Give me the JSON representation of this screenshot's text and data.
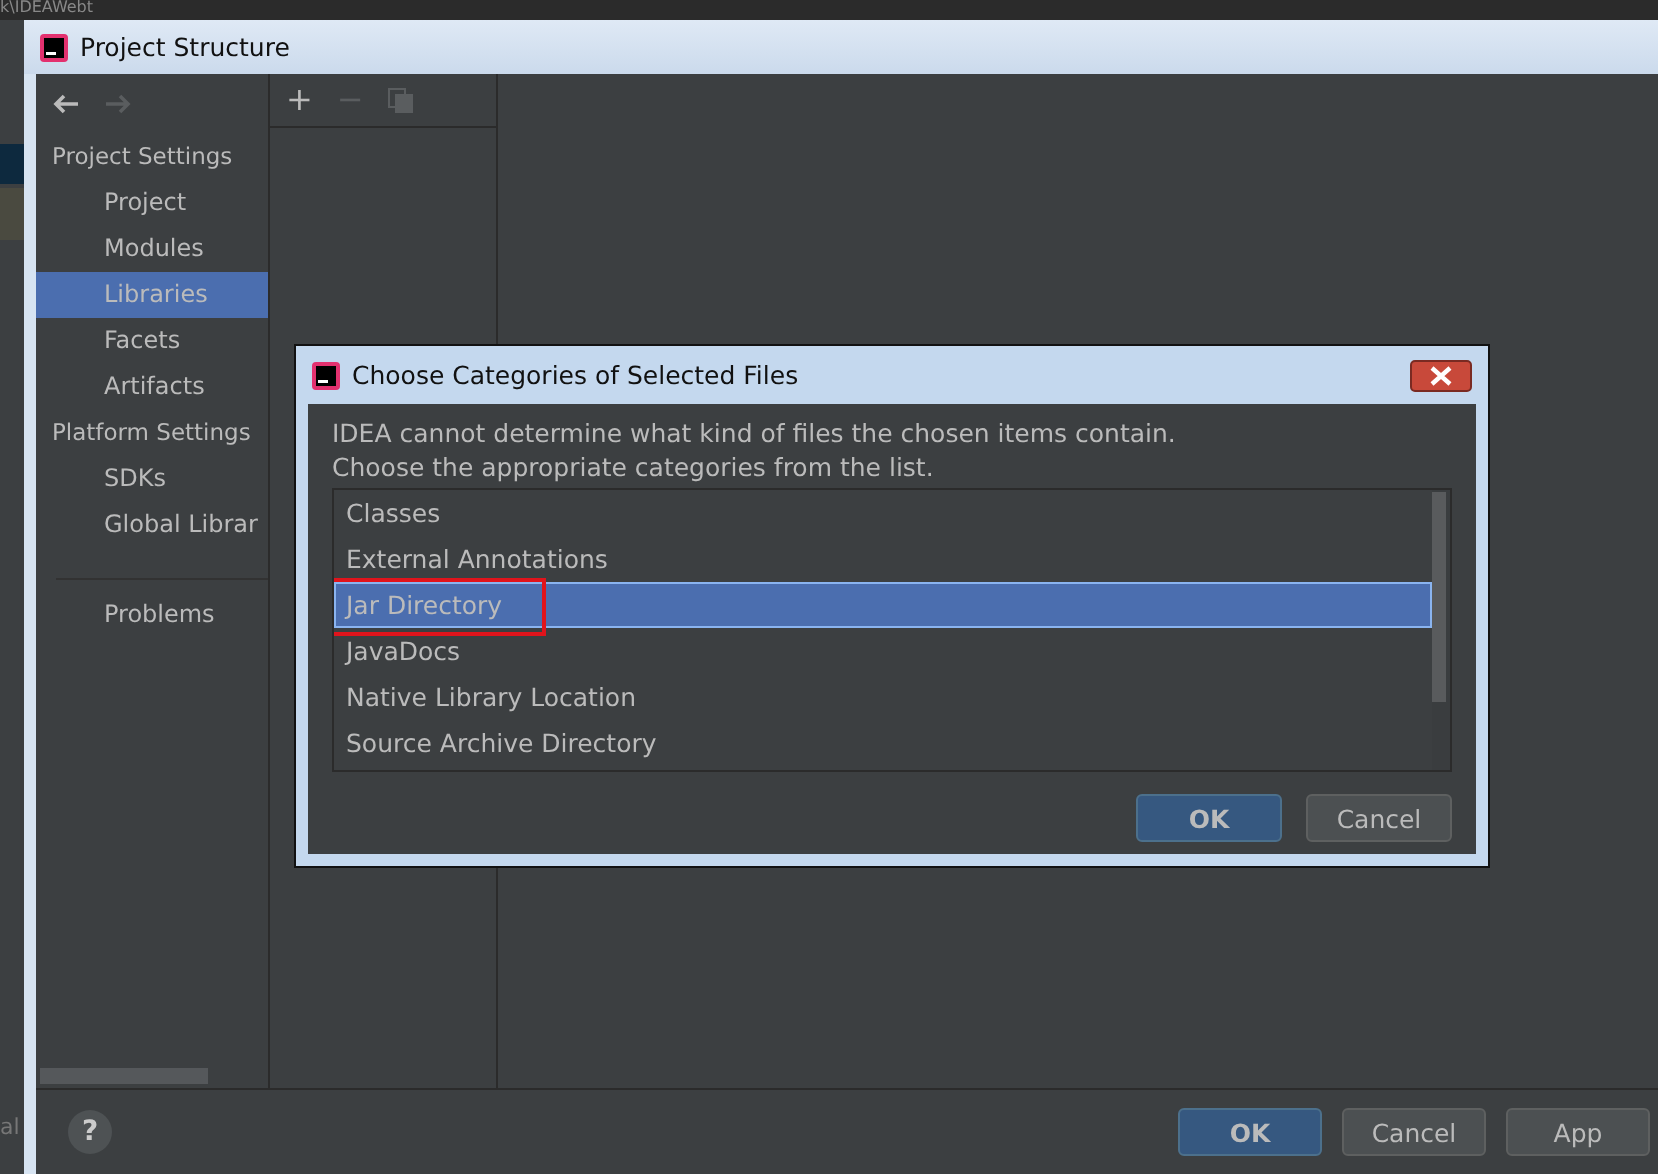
{
  "ide": {
    "path": "k\\IDEAWebt",
    "fragment": "al"
  },
  "window": {
    "title": "Project Structure"
  },
  "toolbar": [
    "+",
    "−"
  ],
  "sidebar": [
    {
      "heading": "Project Settings",
      "items": [
        {
          "label": "Project",
          "selected": false
        },
        {
          "label": "Modules",
          "selected": false
        },
        {
          "label": "Libraries",
          "selected": true
        },
        {
          "label": "Facets",
          "selected": false
        },
        {
          "label": "Artifacts",
          "selected": false
        }
      ]
    },
    {
      "heading": "Platform Settings",
      "items": [
        {
          "label": "SDKs",
          "selected": false
        },
        {
          "label": "Global Librar",
          "selected": false
        }
      ]
    },
    {
      "items": [
        {
          "label": "Problems",
          "selected": false
        }
      ]
    }
  ],
  "dialog": {
    "title": "Choose Categories of Selected Files",
    "message": [
      "IDEA cannot determine what kind of files the chosen items contain.",
      "Choose the appropriate categories from the list."
    ],
    "categories": [
      {
        "label": "Classes",
        "selected": false,
        "highlighted": false
      },
      {
        "label": "External Annotations",
        "selected": false,
        "highlighted": false
      },
      {
        "label": "Jar Directory",
        "selected": true,
        "highlighted": true
      },
      {
        "label": "JavaDocs",
        "selected": false,
        "highlighted": false
      },
      {
        "label": "Native Library Location",
        "selected": false,
        "highlighted": false
      },
      {
        "label": "Source Archive Directory",
        "selected": false,
        "highlighted": false
      }
    ],
    "buttons": [
      {
        "label": "OK",
        "kind": "primary"
      },
      {
        "label": "Cancel",
        "kind": "secondary"
      }
    ]
  },
  "footer": {
    "help": "?",
    "buttons": [
      {
        "label": "OK",
        "kind": "primary"
      },
      {
        "label": "Cancel",
        "kind": "secondary"
      },
      {
        "label": "App",
        "kind": "secondary"
      }
    ]
  }
}
